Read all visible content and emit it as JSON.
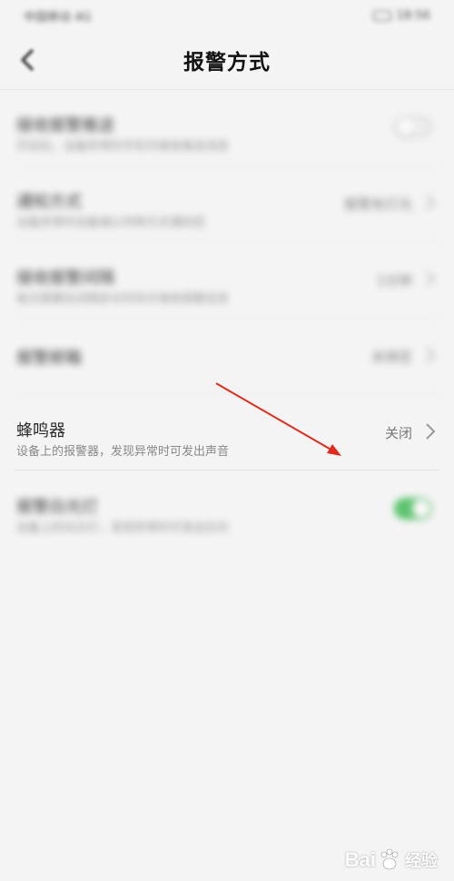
{
  "status_bar": {
    "left": "中国移动 4G",
    "right": "18:56"
  },
  "header": {
    "title": "报警方式"
  },
  "rows": [
    {
      "title": "接收报警推送",
      "subtitle": "开启后，设备异常时手机可接收推送消息",
      "control": "toggle-off"
    },
    {
      "title": "通知方式",
      "subtitle": "设备异常时设备端以何种方式通知您",
      "value": "报警有灯光",
      "control": "chevron"
    },
    {
      "title": "接收报警间隔",
      "subtitle": "每次报警后间隔多长时间才接收报警信息",
      "value": "1分钟",
      "control": "chevron"
    },
    {
      "title": "报警邮箱",
      "value": "未绑定",
      "control": "chevron"
    },
    {
      "title": "蜂鸣器",
      "subtitle": "设备上的报警器，发现异常时可发出声音",
      "value": "关闭",
      "control": "chevron"
    },
    {
      "title": "报警白光灯",
      "subtitle": "设备上的白光灯，发现异常时可发出白光",
      "control": "toggle-on"
    }
  ],
  "colors": {
    "toggle_on": "#4cbf60",
    "arrow": "#e02a1e"
  },
  "watermark": {
    "brand": "Bai",
    "suffix": "经验"
  }
}
